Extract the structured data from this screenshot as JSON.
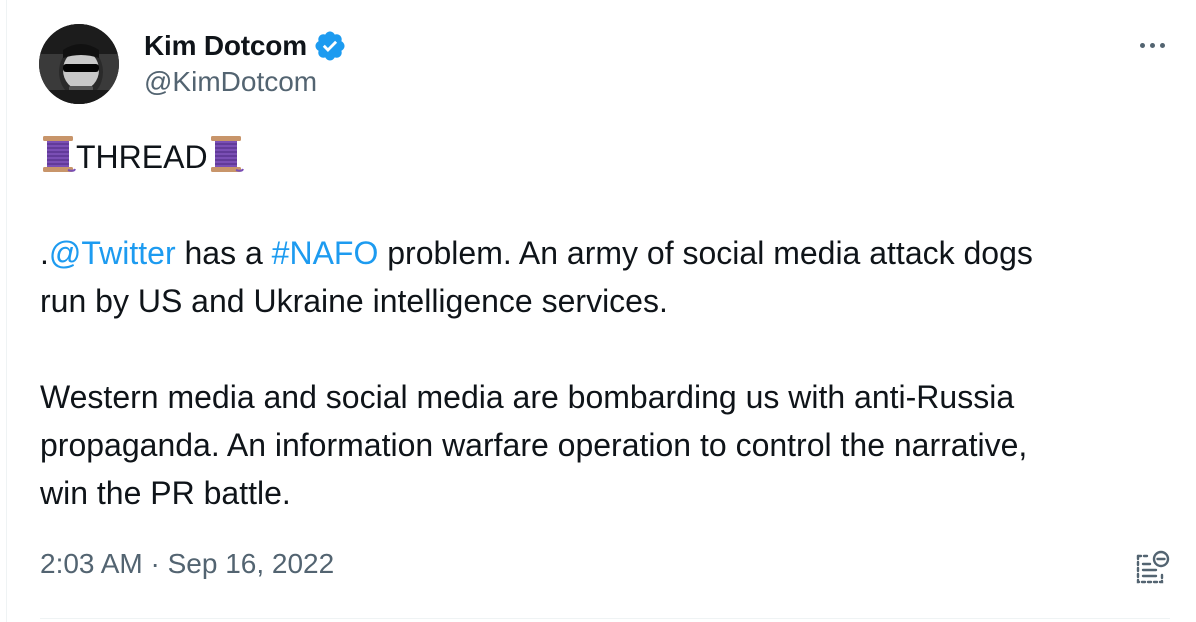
{
  "author": {
    "display_name": "Kim Dotcom",
    "handle": "@KimDotcom",
    "verified": true,
    "avatar_icon": "avatar-photo"
  },
  "tweet": {
    "header_line": "THREAD",
    "header_emoji": "spool-of-thread",
    "paragraph1": {
      "prefix": ".",
      "mention": "@Twitter",
      "middle": " has a ",
      "hashtag": "#NAFO",
      "rest_line1": " problem. An army of social media attack dogs",
      "line2": "run by US and Ukraine intelligence services."
    },
    "paragraph2": {
      "line1": "Western media and social media are bombarding us with anti-Russia",
      "line2": "propaganda. An information warfare operation to control the narrative,",
      "line3": "win the PR battle."
    }
  },
  "meta": {
    "timestamp": "2:03 AM · Sep 16, 2022"
  },
  "icons": {
    "more": "more-icon",
    "verified": "verified-badge-icon",
    "note": "community-note-icon"
  },
  "colors": {
    "link": "#1d9bf0",
    "text": "#0f1419",
    "secondary": "#536471",
    "verified": "#1d9bf0"
  }
}
